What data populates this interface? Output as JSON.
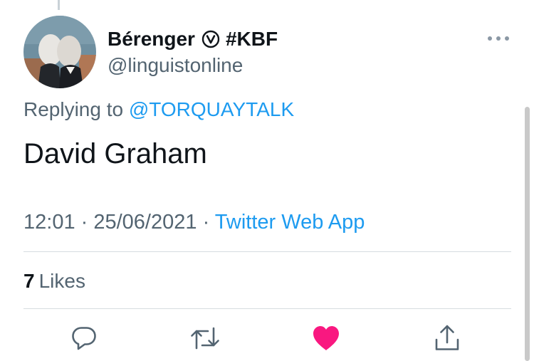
{
  "author": {
    "display_name": "Bérenger",
    "badge_icon": "circled-v-icon",
    "hashtag": "#KBF",
    "handle": "@linguistonline",
    "avatar": "avatar-image"
  },
  "reply": {
    "prefix": "Replying to",
    "mention": "@TORQUAYTALK"
  },
  "tweet": {
    "text": "David Graham"
  },
  "meta": {
    "time": "12:01",
    "separator1": " · ",
    "date": "25/06/2021",
    "separator2": " · ",
    "source": "Twitter Web App"
  },
  "stats": {
    "likes_count": "7",
    "likes_label": "Likes"
  },
  "actions": [
    {
      "name": "reply-icon"
    },
    {
      "name": "retweet-icon"
    },
    {
      "name": "like-icon"
    },
    {
      "name": "share-icon"
    }
  ],
  "colors": {
    "accent": "#1d9bf0",
    "like": "#f91880",
    "text": "#0f1419",
    "secondary": "#536471"
  }
}
